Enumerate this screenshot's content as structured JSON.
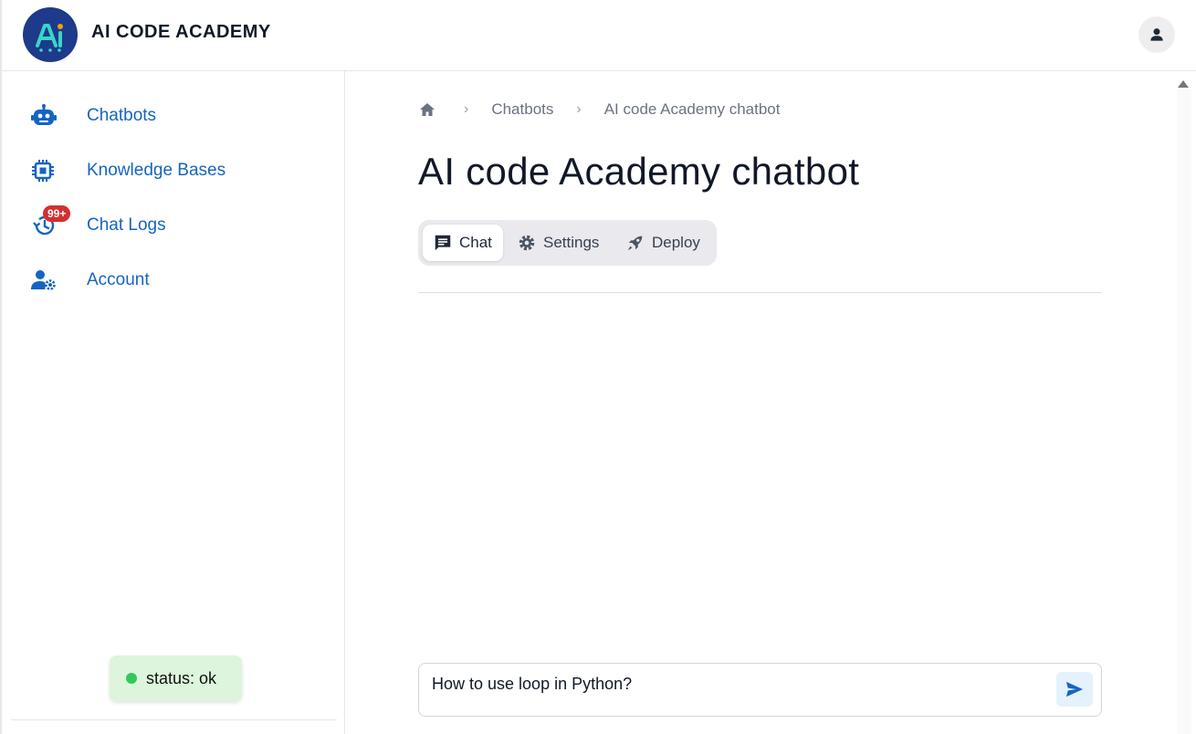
{
  "app": {
    "brand": "AI CODE ACADEMY",
    "logo_text": "Ai"
  },
  "sidebar": {
    "items": [
      {
        "label": "Chatbots",
        "icon": "robot-icon"
      },
      {
        "label": "Knowledge Bases",
        "icon": "chip-icon"
      },
      {
        "label": "Chat Logs",
        "icon": "history-icon",
        "badge": "99+"
      },
      {
        "label": "Account",
        "icon": "user-settings-icon"
      }
    ],
    "status": "status: ok"
  },
  "breadcrumb": {
    "home_icon": "home-icon",
    "separator": "›",
    "items": [
      "Chatbots",
      "AI code Academy chatbot"
    ]
  },
  "page": {
    "title": "AI code Academy chatbot"
  },
  "tabs": [
    {
      "label": "Chat",
      "icon": "message-icon",
      "active": true
    },
    {
      "label": "Settings",
      "icon": "gear-icon",
      "active": false
    },
    {
      "label": "Deploy",
      "icon": "rocket-icon",
      "active": false
    }
  ],
  "chat": {
    "input_value": "How to use loop in Python?",
    "send_icon": "send-icon"
  },
  "colors": {
    "accent": "#1565c0",
    "badge": "#d32f2f",
    "status_bg": "#dcf5dc",
    "status_dot": "#34c759"
  }
}
